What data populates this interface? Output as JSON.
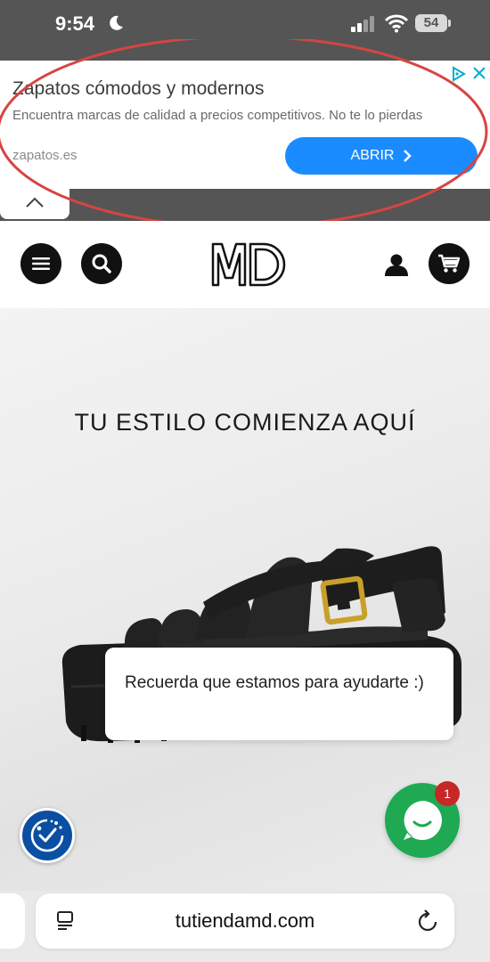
{
  "status_bar": {
    "time": "9:54",
    "battery": "54",
    "icons": [
      "moon-icon",
      "signal-icon",
      "wifi-icon",
      "battery-icon"
    ]
  },
  "ad": {
    "title": "Zapatos cómodos y modernos",
    "description": "Encuentra marcas de calidad a precios competitivos. No te lo pierdas",
    "domain": "zapatos.es",
    "button_label": "ABRIR",
    "icons": [
      "adchoices-icon",
      "close-icon",
      "chevron-up-icon",
      "chevron-right-icon"
    ],
    "button_color": "#1a8cff",
    "highlight_color": "#d64541"
  },
  "header": {
    "logo": "MD",
    "icons": [
      "menu-icon",
      "search-icon",
      "user-icon",
      "cart-icon"
    ]
  },
  "hero": {
    "title": "TU ESTILO COMIENZA AQUÍ"
  },
  "chat": {
    "message": "Recuerda que estamos para ayudarte :)",
    "badge_count": "1",
    "whatsapp_color": "#1ea952"
  },
  "accessibility": {
    "icon": "accessibility-icon",
    "color": "#0b4fa3"
  },
  "browser": {
    "url": "tutiendamd.com",
    "icons": [
      "reader-icon",
      "reload-icon"
    ]
  }
}
